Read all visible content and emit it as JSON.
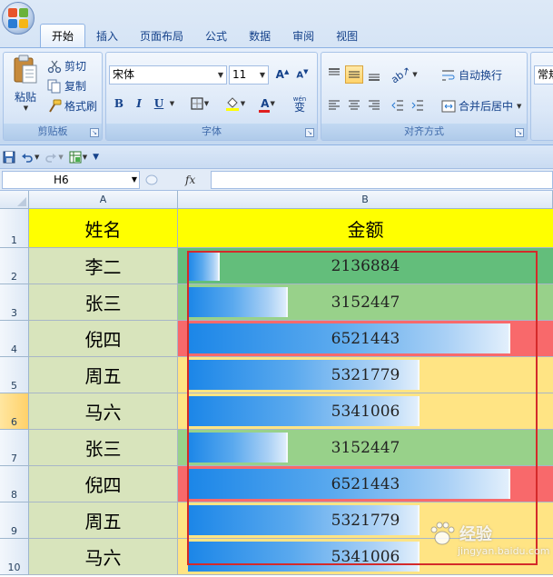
{
  "ribbon": {
    "tabs": [
      "开始",
      "插入",
      "页面布局",
      "公式",
      "数据",
      "审阅",
      "视图"
    ],
    "active_tab": "开始",
    "clipboard": {
      "paste_label": "粘贴",
      "cut_label": "剪切",
      "copy_label": "复制",
      "format_painter_label": "格式刷",
      "group_label": "剪贴板"
    },
    "font": {
      "font_name": "宋体",
      "font_size": "11",
      "bold": "B",
      "italic": "I",
      "underline": "U",
      "font_color_glyph": "A",
      "phonetic_glyph": "wén",
      "phonetic_char": "变",
      "group_label": "字体"
    },
    "alignment": {
      "wrap_text_label": "自动换行",
      "merge_center_label": "合并后居中",
      "group_label": "对齐方式"
    },
    "number": {
      "format_value": "常规"
    }
  },
  "namebox": {
    "value": "H6"
  },
  "formula_bar": {
    "fx": "fx",
    "value": ""
  },
  "columns": [
    "A",
    "B"
  ],
  "rows": [
    {
      "num": "1",
      "name": "姓名",
      "amount": "金额",
      "header": true
    },
    {
      "num": "2",
      "name": "李二",
      "amount": "2136884",
      "icon": "green",
      "bar": 0.06
    },
    {
      "num": "3",
      "name": "张三",
      "amount": "3152447",
      "icon": "green",
      "bar": 0.27
    },
    {
      "num": "4",
      "name": "倪四",
      "amount": "6521443",
      "icon": "red",
      "bar": 0.96
    },
    {
      "num": "5",
      "name": "周五",
      "amount": "5321779",
      "icon": "yellow",
      "bar": 0.68
    },
    {
      "num": "6",
      "name": "马六",
      "amount": "5341006",
      "icon": "yellow",
      "bar": 0.68
    },
    {
      "num": "7",
      "name": "张三",
      "amount": "3152447",
      "icon": "green",
      "bar": 0.27
    },
    {
      "num": "8",
      "name": "倪四",
      "amount": "6521443",
      "icon": "red",
      "bar": 0.96
    },
    {
      "num": "9",
      "name": "周五",
      "amount": "5321779",
      "icon": "yellow",
      "bar": 0.68
    },
    {
      "num": "10",
      "name": "马六",
      "amount": "5341006",
      "icon": "yellow",
      "bar": 0.68
    }
  ],
  "selected_row": "6",
  "colors": {
    "header_fill": "#ffff00",
    "name_fill": "#d8e4bc",
    "scale_green_dark": "#63be7b",
    "scale_green_light": "#98d18a",
    "scale_yellow": "#ffe484",
    "scale_red": "#f8696b",
    "selection_border": "#d42a2a"
  },
  "watermark": {
    "text": "经验",
    "url": "jingyan.baidu.com"
  }
}
